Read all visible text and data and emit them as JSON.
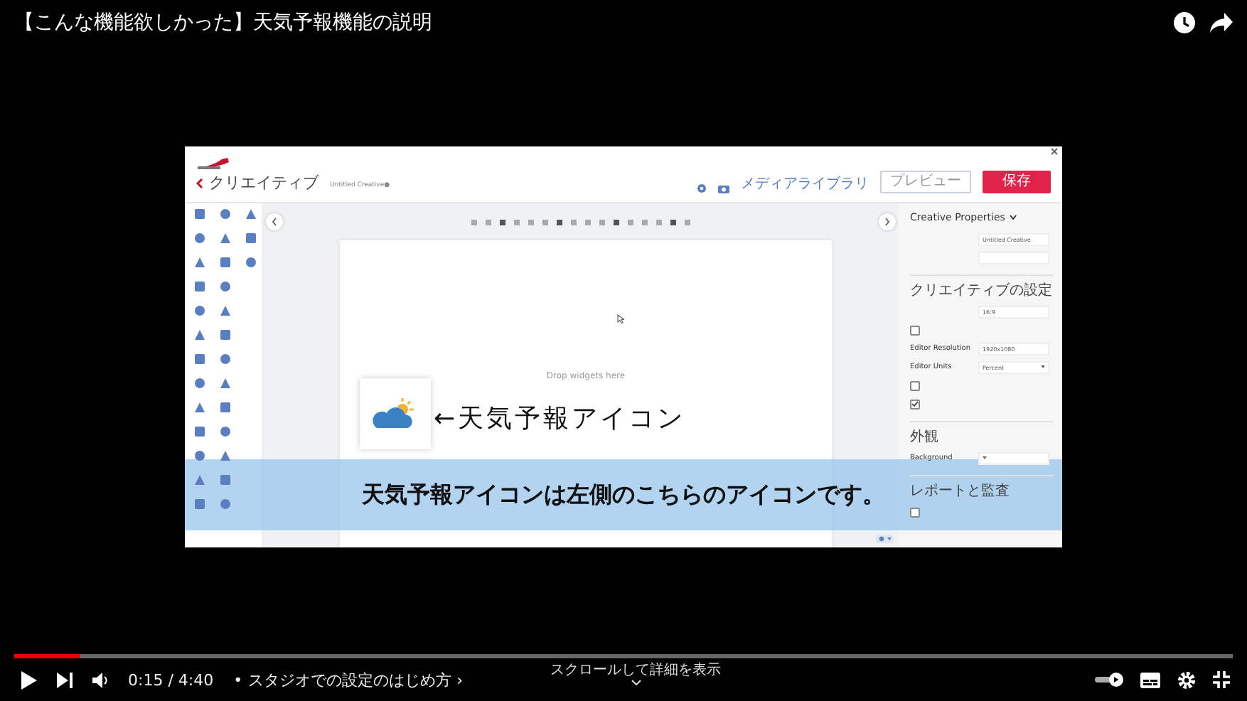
{
  "video_title": "【こんな機能欲しかった】天気予報機能の説明",
  "video_frame": {
    "app": {
      "back_title": "クリエイティブ",
      "document_name": "Untitled Creative●",
      "media_library": "メディアライブラリ",
      "buttons": [
        {
          "label": "プレビュー",
          "kind": "secondary"
        },
        {
          "label": "保存",
          "kind": "primary"
        }
      ],
      "canvas_placeholder": "Drop widgets here",
      "panel": {
        "title": "Creative Properties",
        "rows": [
          {
            "kind": "field",
            "value": "Untitled Creative"
          },
          {
            "kind": "field"
          },
          {
            "kind": "heading",
            "text": "クリエイティブの設定"
          },
          {
            "kind": "field",
            "value": "16:9"
          },
          {
            "kind": "check",
            "checked": false
          },
          {
            "kind": "field",
            "label": "Editor Resolution",
            "value": "1920x1080"
          },
          {
            "kind": "select",
            "label": "Editor Units",
            "value": "Percent"
          },
          {
            "kind": "check",
            "checked": false
          },
          {
            "kind": "check",
            "checked": true
          },
          {
            "kind": "heading",
            "text": "外観"
          },
          {
            "kind": "select",
            "label": "Background"
          },
          {
            "kind": "heading",
            "text": "レポートと監査"
          },
          {
            "kind": "check",
            "checked": false
          }
        ]
      }
    },
    "icon_caption": "←天気予報アイコン",
    "subtitle": "天気予報アイコンは左側のこちらのアイコンです。"
  },
  "player": {
    "progress": {
      "level": 0.054
    },
    "time": "0:15 / 4:40",
    "separator": "•",
    "chapter": "スタジオでの設定のはじめ方 ›",
    "scroll_hint": "スクロールして詳細を表示",
    "autoplay": {
      "on": true
    }
  }
}
